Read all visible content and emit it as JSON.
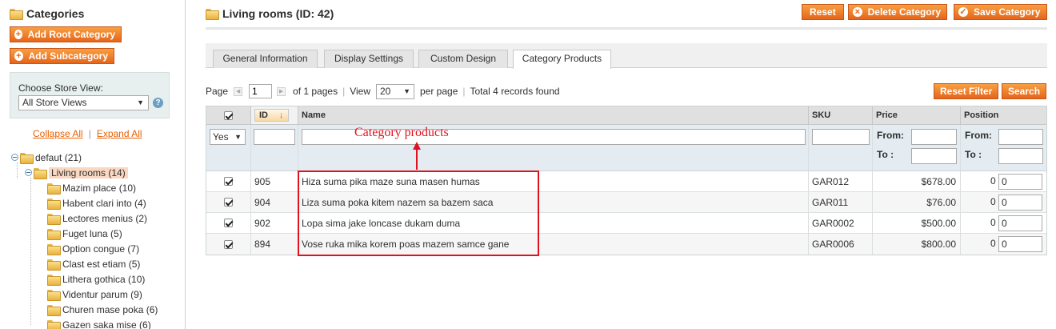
{
  "sidebar": {
    "title": "Categories",
    "add_root_label": "Add Root Category",
    "add_sub_label": "Add Subcategory",
    "store_view_label": "Choose Store View:",
    "store_view_value": "All Store Views",
    "collapse_all": "Collapse All",
    "expand_all": "Expand All",
    "tree": [
      {
        "label": "defaut (21)",
        "level": 0,
        "expanded": true
      },
      {
        "label": "Living rooms (14)",
        "level": 1,
        "expanded": true,
        "selected": true
      },
      {
        "label": "Mazim place (10)",
        "level": 2
      },
      {
        "label": "Habent clari into (4)",
        "level": 2
      },
      {
        "label": "Lectores menius (2)",
        "level": 2
      },
      {
        "label": "Fuget luna (5)",
        "level": 2
      },
      {
        "label": "Option congue (7)",
        "level": 2
      },
      {
        "label": "Clast est etiam (5)",
        "level": 2
      },
      {
        "label": "Lithera gothica (10)",
        "level": 2
      },
      {
        "label": "Videntur parum (9)",
        "level": 2
      },
      {
        "label": "Churen mase poka (6)",
        "level": 2
      },
      {
        "label": "Gazen saka mise (6)",
        "level": 2
      }
    ]
  },
  "header": {
    "title": "Living rooms (ID: 42)",
    "reset_label": "Reset",
    "delete_label": "Delete Category",
    "save_label": "Save Category"
  },
  "tabs": [
    {
      "label": "General Information"
    },
    {
      "label": "Display Settings"
    },
    {
      "label": "Custom Design"
    },
    {
      "label": "Category Products",
      "active": true
    }
  ],
  "pager": {
    "page_label": "Page",
    "page_value": "1",
    "of_pages": "of 1 pages",
    "view_label": "View",
    "per_page_value": "20",
    "per_page_label": "per page",
    "total": "Total 4 records found",
    "reset_filter": "Reset Filter",
    "search": "Search"
  },
  "grid": {
    "columns": {
      "id": "ID",
      "name": "Name",
      "sku": "SKU",
      "price": "Price",
      "position": "Position"
    },
    "filter": {
      "in_category": "Yes",
      "from": "From:",
      "to": "To :"
    },
    "rows": [
      {
        "checked": true,
        "id": "905",
        "name": "Hiza suma pika maze suna masen humas",
        "sku": "GAR012",
        "price": "$678.00",
        "position": "0",
        "position_input": "0"
      },
      {
        "checked": true,
        "id": "904",
        "name": "Liza suma poka kitem nazem sa bazem saca",
        "sku": "GAR011",
        "price": "$76.00",
        "position": "0",
        "position_input": "0"
      },
      {
        "checked": true,
        "id": "902",
        "name": "Lopa sima jake loncase dukam duma",
        "sku": "GAR0002",
        "price": "$500.00",
        "position": "0",
        "position_input": "0"
      },
      {
        "checked": true,
        "id": "894",
        "name": "Vose ruka mika korem poas mazem samce gane",
        "sku": "GAR0006",
        "price": "$800.00",
        "position": "0",
        "position_input": "0"
      }
    ]
  },
  "annotation": {
    "label": "Category products",
    "color": "#e0121e"
  },
  "colors": {
    "accent": "#e5651b",
    "link": "#eb5e00"
  }
}
